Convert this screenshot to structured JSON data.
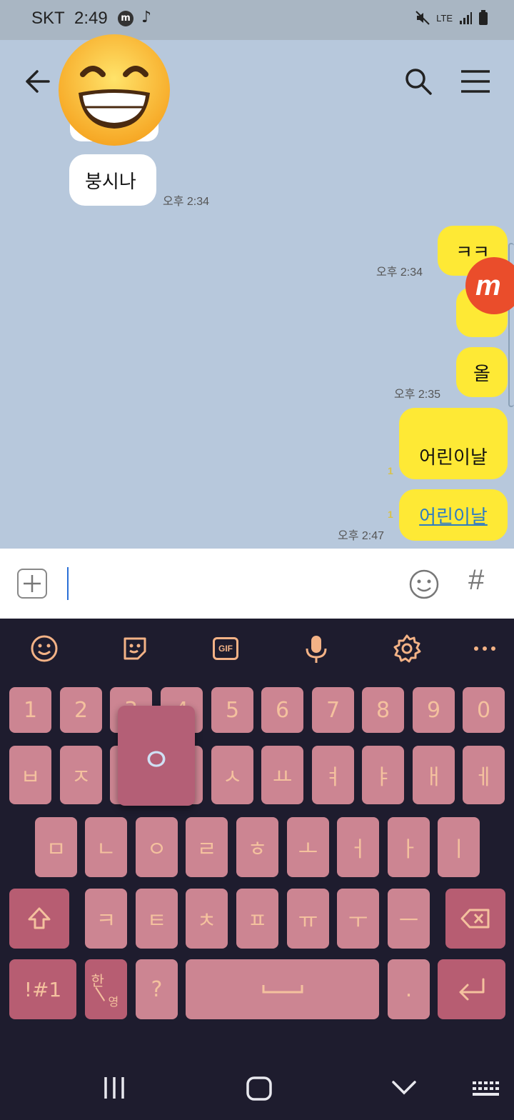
{
  "status_bar": {
    "carrier": "SKT",
    "time": "2:49",
    "network": "LTE"
  },
  "messages": [
    {
      "direction": "in",
      "text": "붕시나",
      "time": "오후 2:34"
    },
    {
      "direction": "out",
      "text": "ㅋㅋ",
      "time": "오후 2:34"
    },
    {
      "direction": "out",
      "text": "올",
      "time": "오후 2:35"
    },
    {
      "direction": "out",
      "text": "어린이날",
      "unread": "1"
    },
    {
      "direction": "out",
      "text": "어린이날",
      "unread": "1",
      "time": "오후 2:47",
      "link": true
    }
  ],
  "input": {
    "value": "",
    "hash_label": "#"
  },
  "keyboard": {
    "toolbar": [
      "emoji-icon",
      "sticker-icon",
      "gif-icon",
      "microphone-icon",
      "gear-icon",
      "more-icon"
    ],
    "gif_label": "GIF",
    "rows": [
      [
        "1",
        "2",
        "3",
        "4",
        "5",
        "6",
        "7",
        "8",
        "9",
        "0"
      ],
      [
        "ㅂ",
        "ㅈ",
        "ㄷ",
        "ㄱ",
        "ㅅ",
        "ㅛ",
        "ㅕ",
        "ㅑ",
        "ㅐ",
        "ㅔ"
      ],
      [
        "ㅁ",
        "ㄴ",
        "ㅇ",
        "ㄹ",
        "ㅎ",
        "ㅗ",
        "ㅓ",
        "ㅏ",
        "ㅣ"
      ],
      [
        "ㅋ",
        "ㅌ",
        "ㅊ",
        "ㅍ",
        "ㅠ",
        "ㅜ",
        "ㅡ"
      ]
    ],
    "popup_key": "ㅇ",
    "symbol_key": "!#1",
    "lang_key_top": "한",
    "lang_key_bottom": "영",
    "question_key": "?",
    "period_key": "."
  },
  "colors": {
    "chat_bg": "#b7c8dc",
    "outgoing_bubble": "#fee935",
    "key_bg": "#cc8592",
    "key_text": "#f4c19e"
  }
}
